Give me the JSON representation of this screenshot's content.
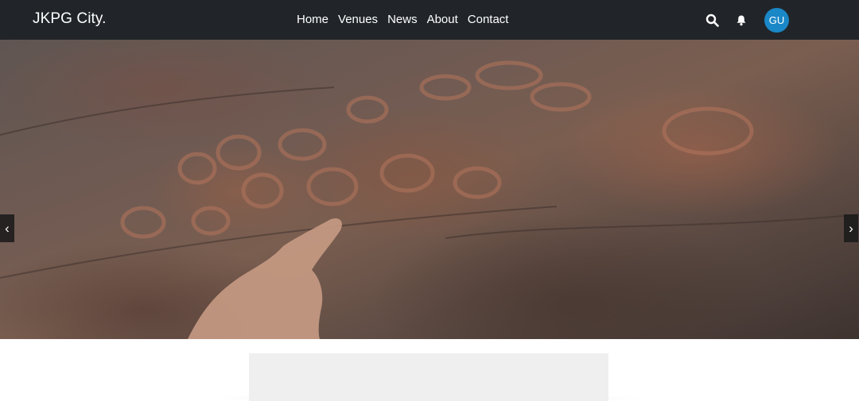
{
  "navbar": {
    "brand": "JKPG City.",
    "links": [
      {
        "label": "Home"
      },
      {
        "label": "Venues"
      },
      {
        "label": "News"
      },
      {
        "label": "About"
      },
      {
        "label": "Contact"
      }
    ],
    "icons": {
      "search": "search-icon",
      "bell": "bell-icon"
    },
    "avatar_initials": "GU",
    "colors": {
      "background": "#212529",
      "avatar": "#1a87c7"
    }
  },
  "hero": {
    "image": "rock-carvings-photo",
    "prev_label": "‹",
    "next_label": "›"
  }
}
